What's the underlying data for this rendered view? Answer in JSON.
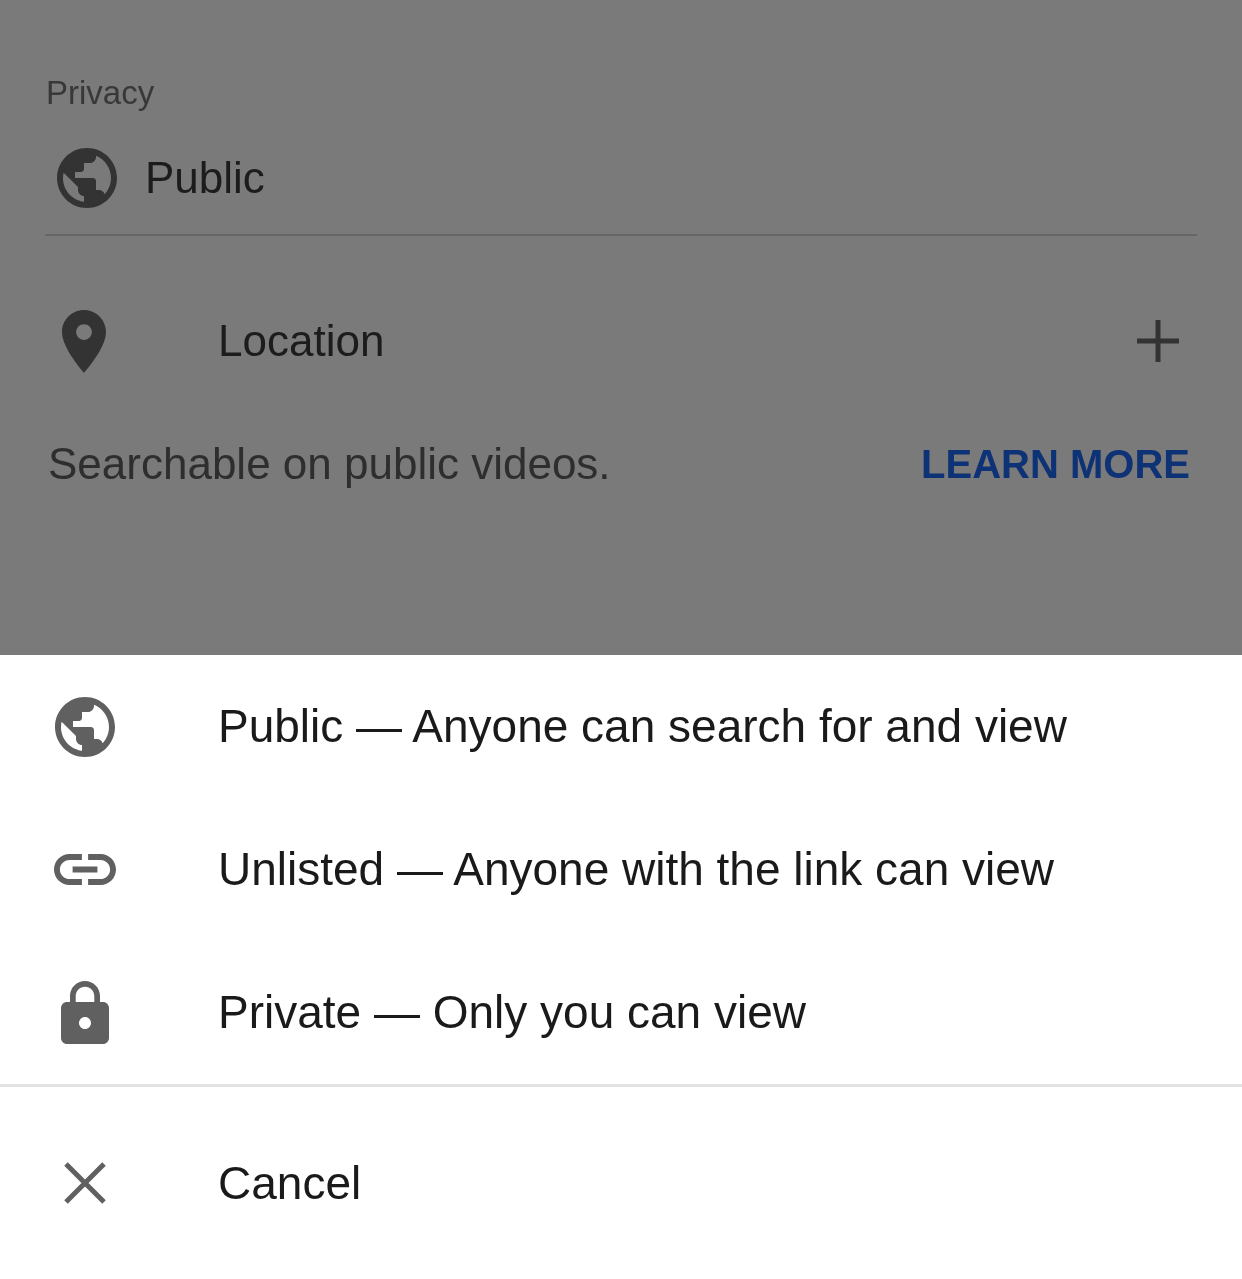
{
  "privacy_field": {
    "label": "Privacy",
    "kind": "public",
    "value": "Public"
  },
  "location_row": {
    "label": "Location"
  },
  "location_note": {
    "text": "Searchable on public videos.",
    "link": "LEARN MORE"
  },
  "privacy_menu": {
    "options": [
      {
        "kind": "public",
        "label": "Public — Anyone can search for and view"
      },
      {
        "kind": "unlisted",
        "label": "Unlisted — Anyone with the link can view"
      },
      {
        "kind": "private",
        "label": "Private — Only you can view"
      }
    ],
    "cancel": "Cancel"
  }
}
